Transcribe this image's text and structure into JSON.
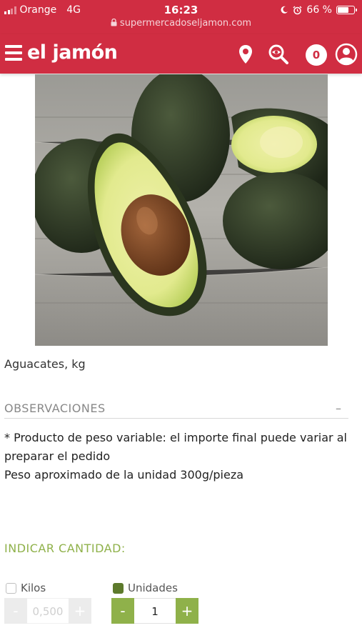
{
  "status_bar": {
    "carrier": "Orange",
    "network": "4G",
    "time": "16:23",
    "battery": "66 %",
    "battery_level": 0.66,
    "url": "supermercadoseljamon.com"
  },
  "header": {
    "logo": "el jamón",
    "cart_count": "0",
    "icons": [
      "menu-icon",
      "location-pin-icon",
      "search-icon",
      "user-icon"
    ]
  },
  "product": {
    "image": "avocado-photo",
    "name": "Aguacates, kg"
  },
  "observations": {
    "title": "OBSERVACIONES",
    "toggle": "–",
    "line1": "* Producto de peso variable: el importe final puede variar al preparar el pedido",
    "line2": "Peso aproximado de la unidad 300g/pieza"
  },
  "quantity": {
    "title": "INDICAR CANTIDAD:",
    "kilos_label": "Kilos",
    "units_label": "Unidades",
    "kilos_value": "0,500",
    "units_value": "1",
    "minus": "-",
    "plus": "+",
    "selected": "Unidades"
  },
  "colors": {
    "brand": "#d02d42",
    "accent_green": "#8fb14a",
    "checkbox_green": "#5d7a2c"
  }
}
